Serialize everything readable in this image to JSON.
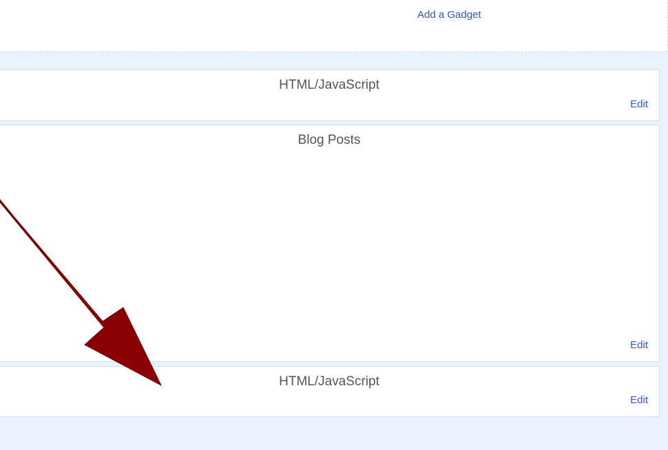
{
  "add_gadget": {
    "label": "Add a Gadget"
  },
  "widgets": [
    {
      "title": "HTML/JavaScript",
      "edit_label": "Edit"
    },
    {
      "title": "Blog Posts",
      "edit_label": "Edit"
    },
    {
      "title": "HTML/JavaScript",
      "edit_label": "Edit"
    }
  ],
  "annotation": {
    "icon": "red-arrow-icon",
    "color": "#8b0000"
  },
  "colors": {
    "link": "#3355cc",
    "page_background": "#eaf2fd",
    "widget_border": "#cfdff2"
  }
}
